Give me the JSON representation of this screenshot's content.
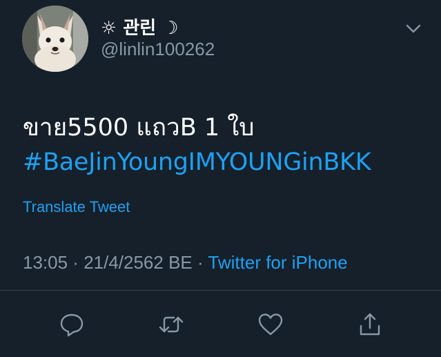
{
  "tweet": {
    "display_name": "☼ 관린 ☽",
    "handle": "@linlin100262",
    "text": "ขาย5500 แถวB 1 ใบ",
    "hashtag": "#BaeJinYoungIMYOUNGinBKK",
    "translate_label": "Translate Tweet",
    "time": "13:05",
    "date": "21/4/2562 BE",
    "separator": " · ",
    "source": "Twitter for iPhone"
  },
  "icons": {
    "avatar": "chihuahua-avatar",
    "more": "chevron-down-icon",
    "reply": "reply-icon",
    "retweet": "retweet-icon",
    "like": "heart-icon",
    "share": "share-icon"
  },
  "colors": {
    "background": "#15202b",
    "accent": "#1da1f2",
    "secondary_text": "#8899a6",
    "primary_text": "#ffffff"
  }
}
